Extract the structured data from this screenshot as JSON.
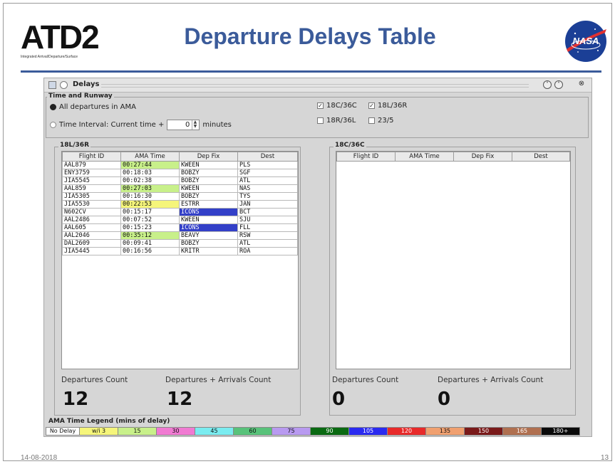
{
  "slide": {
    "logo_text": "ATD2",
    "logo_subtitle": "Integrated Arrival/Departure/Surface",
    "title": "Departure Delays Table",
    "nasa_logo_text": "NASA",
    "footer_date": "14-08-2018",
    "page_number": "13"
  },
  "window": {
    "title": "Delays"
  },
  "time_runway": {
    "group_label": "Time and Runway",
    "all_departures_label": "All departures in AMA",
    "all_departures_selected": true,
    "time_interval_label": "Time Interval: Current time +",
    "time_interval_value": "0",
    "time_interval_unit": "minutes",
    "runways": [
      {
        "label": "18C/36C",
        "checked": true
      },
      {
        "label": "18L/36R",
        "checked": true
      },
      {
        "label": "18R/36L",
        "checked": false
      },
      {
        "label": "23/5",
        "checked": false
      }
    ]
  },
  "panels": [
    {
      "label": "18L/36R",
      "columns": [
        "Flight ID",
        "AMA Time",
        "Dep Fix",
        "Dest"
      ],
      "rows": [
        {
          "flight": "AAL879",
          "time": "00:27:44",
          "fix": "KWEEN",
          "dest": "PLS",
          "time_color": "#c8f08a",
          "fix_color": ""
        },
        {
          "flight": "ENY3759",
          "time": "00:18:03",
          "fix": "BOBZY",
          "dest": "SGF",
          "time_color": "",
          "fix_color": ""
        },
        {
          "flight": "JIA5545",
          "time": "00:02:38",
          "fix": "BOBZY",
          "dest": "ATL",
          "time_color": "",
          "fix_color": ""
        },
        {
          "flight": "AAL859",
          "time": "00:27:03",
          "fix": "KWEEN",
          "dest": "NAS",
          "time_color": "#c8f08a",
          "fix_color": ""
        },
        {
          "flight": "JIA5305",
          "time": "00:16:30",
          "fix": "BOBZY",
          "dest": "TYS",
          "time_color": "",
          "fix_color": ""
        },
        {
          "flight": "JIA5530",
          "time": "00:22:53",
          "fix": "ESTRR",
          "dest": "JAN",
          "time_color": "#f5f57a",
          "fix_color": ""
        },
        {
          "flight": "N602CV",
          "time": "00:15:17",
          "fix": "ICONS",
          "dest": "BCT",
          "time_color": "",
          "fix_color": "#3340c8"
        },
        {
          "flight": "AAL2486",
          "time": "00:07:52",
          "fix": "KWEEN",
          "dest": "SJU",
          "time_color": "",
          "fix_color": ""
        },
        {
          "flight": "AAL605",
          "time": "00:15:23",
          "fix": "ICONS",
          "dest": "FLL",
          "time_color": "",
          "fix_color": "#3340c8"
        },
        {
          "flight": "AAL2046",
          "time": "00:35:12",
          "fix": "BEAVY",
          "dest": "RSW",
          "time_color": "#c8f08a",
          "fix_color": ""
        },
        {
          "flight": "DAL2609",
          "time": "00:09:41",
          "fix": "BOBZY",
          "dest": "ATL",
          "time_color": "",
          "fix_color": ""
        },
        {
          "flight": "JIA5445",
          "time": "00:16:56",
          "fix": "KRITR",
          "dest": "ROA",
          "time_color": "",
          "fix_color": ""
        }
      ],
      "departures_count_label": "Departures Count",
      "departures_count": "12",
      "dep_arr_count_label": "Departures + Arrivals Count",
      "dep_arr_count": "12"
    },
    {
      "label": "18C/36C",
      "columns": [
        "Flight ID",
        "AMA Time",
        "Dep Fix",
        "Dest"
      ],
      "rows": [],
      "departures_count_label": "Departures Count",
      "departures_count": "0",
      "dep_arr_count_label": "Departures + Arrivals Count",
      "dep_arr_count": "0"
    }
  ],
  "legend": {
    "label": "AMA Time Legend (mins of delay)",
    "items": [
      {
        "label": "No Delay",
        "color": "#ffffff",
        "text_color": "#111111"
      },
      {
        "label": "w/i 3",
        "color": "#f5f57a",
        "text_color": "#111111"
      },
      {
        "label": "15",
        "color": "#c8f08a",
        "text_color": "#111111"
      },
      {
        "label": "30",
        "color": "#f07ad2",
        "text_color": "#111111"
      },
      {
        "label": "45",
        "color": "#7aecf0",
        "text_color": "#111111"
      },
      {
        "label": "60",
        "color": "#58c27a",
        "text_color": "#111111"
      },
      {
        "label": "75",
        "color": "#b89af0",
        "text_color": "#111111"
      },
      {
        "label": "90",
        "color": "#0a6a12",
        "text_color": "#ffffff"
      },
      {
        "label": "105",
        "color": "#2a2af0",
        "text_color": "#ffffff"
      },
      {
        "label": "120",
        "color": "#e82a2a",
        "text_color": "#ffffff"
      },
      {
        "label": "135",
        "color": "#f0a070",
        "text_color": "#111111"
      },
      {
        "label": "150",
        "color": "#7a1a1a",
        "text_color": "#ffffff"
      },
      {
        "label": "165",
        "color": "#b07050",
        "text_color": "#ffffff"
      },
      {
        "label": "180+",
        "color": "#0a0a0a",
        "text_color": "#ffffff"
      }
    ]
  }
}
